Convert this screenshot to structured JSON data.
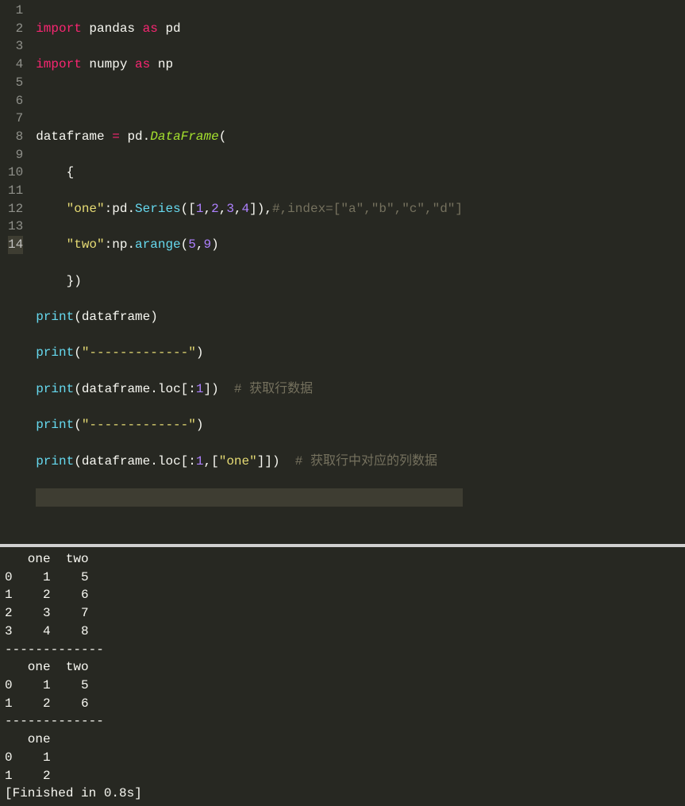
{
  "editor": {
    "gutter": [
      "1",
      "2",
      "3",
      "4",
      "5",
      "6",
      "7",
      "8",
      "9",
      "10",
      "11",
      "12",
      "13",
      "14"
    ],
    "activeLine": 14,
    "lines": {
      "l1": {
        "kw_import": "import",
        "mod": "pandas",
        "kw_as": "as",
        "alias": "pd"
      },
      "l2": {
        "kw_import": "import",
        "mod": "numpy",
        "kw_as": "as",
        "alias": "np"
      },
      "l4": {
        "var": "dataframe",
        "assign": "=",
        "obj": "pd",
        "dot": ".",
        "cls": "DataFrame",
        "open": "("
      },
      "l5": {
        "brace": "{"
      },
      "l6": {
        "key": "\"one\"",
        "colon": ":",
        "obj": "pd",
        "dot": ".",
        "fn": "Series",
        "open": "(",
        "lbr": "[",
        "n1": "1",
        "c1": ",",
        "n2": "2",
        "c2": ",",
        "n3": "3",
        "c3": ",",
        "n4": "4",
        "rbr": "]",
        "close": ")",
        "comma": ",",
        "cmt": "#,index=[\"a\",\"b\",\"c\",\"d\"]"
      },
      "l7": {
        "key": "\"two\"",
        "colon": ":",
        "obj": "np",
        "dot": ".",
        "fn": "arange",
        "open": "(",
        "n1": "5",
        "c1": ",",
        "n2": "9",
        "close": ")"
      },
      "l8": {
        "brace": "})"
      },
      "l9": {
        "fn": "print",
        "open": "(",
        "arg": "dataframe",
        "close": ")"
      },
      "l10": {
        "fn": "print",
        "open": "(",
        "str": "\"-------------\"",
        "close": ")"
      },
      "l11": {
        "fn": "print",
        "open": "(",
        "obj": "dataframe",
        "dot": ".",
        "attr": "loc",
        "lbr": "[",
        "colon": ":",
        "n": "1",
        "rbr": "]",
        "close": ")",
        "sp": "  ",
        "cmt": "# 获取行数据"
      },
      "l12": {
        "fn": "print",
        "open": "(",
        "str": "\"-------------\"",
        "close": ")"
      },
      "l13": {
        "fn": "print",
        "open": "(",
        "obj": "dataframe",
        "dot": ".",
        "attr": "loc",
        "lbr": "[",
        "colon": ":",
        "n": "1",
        "c": ",",
        "lbr2": "[",
        "str": "\"one\"",
        "rbr2": "]",
        "rbr": "]",
        "close": ")",
        "sp": "  ",
        "cmt": "# 获取行中对应的列数据"
      }
    }
  },
  "output": {
    "text": "   one  two\n0    1    5\n1    2    6\n2    3    7\n3    4    8\n-------------\n   one  two\n0    1    5\n1    2    6\n-------------\n   one\n0    1\n1    2\n[Finished in 0.8s]"
  }
}
